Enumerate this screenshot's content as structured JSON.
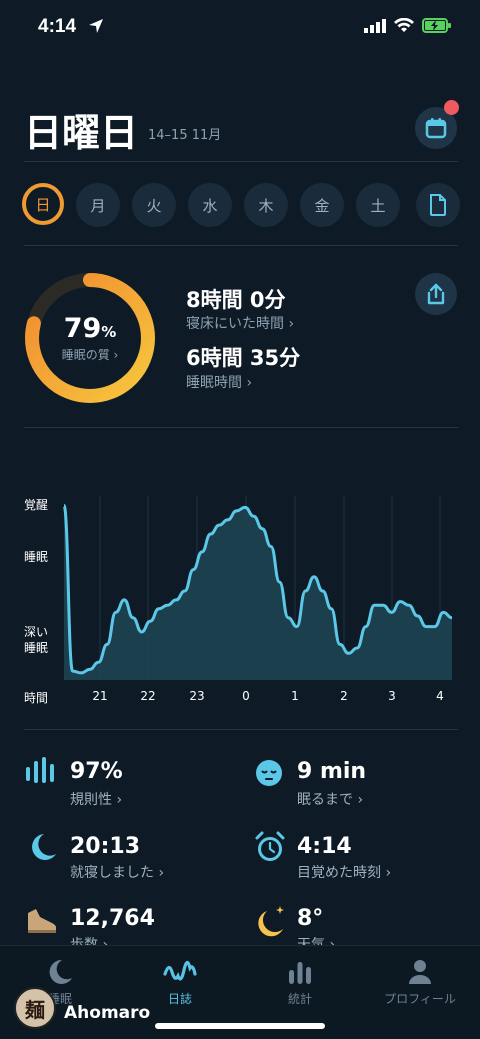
{
  "status": {
    "time": "4:14"
  },
  "header": {
    "title": "日曜日",
    "date": "14–15 11月"
  },
  "days": [
    "日",
    "月",
    "火",
    "水",
    "木",
    "金",
    "土"
  ],
  "summary": {
    "quality_value": "79",
    "quality_unit": "%",
    "quality_label": "睡眠の質 ›",
    "quality_fraction": 0.79,
    "time_in_bed": "8時間 0分",
    "time_in_bed_label": "寝床にいた時間 ›",
    "sleep_time": "6時間 35分",
    "sleep_time_label": "睡眠時間 ›"
  },
  "chart_data": {
    "type": "area",
    "y_levels": [
      "覚醒",
      "睡眠",
      "深い睡眠"
    ],
    "x_axis_label": "時間",
    "x_ticks": [
      "21",
      "22",
      "23",
      "0",
      "1",
      "2",
      "3",
      "4"
    ],
    "series": [
      {
        "values": [
          0.98,
          0.05,
          0.04,
          0.06,
          0.1,
          0.2,
          0.38,
          0.45,
          0.35,
          0.27,
          0.33,
          0.4,
          0.42,
          0.45,
          0.5,
          0.62,
          0.72,
          0.82,
          0.87,
          0.9,
          0.95,
          0.97,
          0.92,
          0.85,
          0.75,
          0.55,
          0.35,
          0.3,
          0.5,
          0.58,
          0.5,
          0.4,
          0.2,
          0.15,
          0.18,
          0.3,
          0.42,
          0.42,
          0.38,
          0.44,
          0.42,
          0.36,
          0.3,
          0.3,
          0.38,
          0.35
        ]
      }
    ],
    "colors": {
      "line": "#5cc8e8",
      "fill": "#1f4555"
    }
  },
  "stats": [
    {
      "value": "97%",
      "label": "規則性 ›",
      "icon": "bars-icon"
    },
    {
      "value": "9 min",
      "label": "眠るまで ›",
      "icon": "sleepy-face-icon"
    },
    {
      "value": "20:13",
      "label": "就寝しました ›",
      "icon": "moon-icon"
    },
    {
      "value": "4:14",
      "label": "目覚めた時刻 ›",
      "icon": "alarm-clock-icon"
    },
    {
      "value": "12,764",
      "label": "歩数 ›",
      "icon": "shoe-icon"
    },
    {
      "value": "8°",
      "label": "天気 ›",
      "icon": "moon-stars-icon"
    }
  ],
  "nav": [
    {
      "label": "睡眠",
      "icon": "moon-icon"
    },
    {
      "label": "日誌",
      "icon": "wave-icon"
    },
    {
      "label": "統計",
      "icon": "chart-bars-icon"
    },
    {
      "label": "プロフィール",
      "icon": "person-icon"
    }
  ],
  "overlay": {
    "username": "Ahomaro",
    "avatar_char": "麺"
  }
}
